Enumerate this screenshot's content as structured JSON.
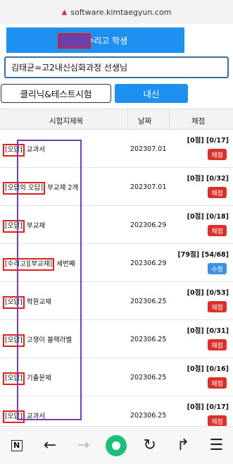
{
  "browser": {
    "url": "software.kimtaegyun.com",
    "warning_icon": "warning-triangle-icon"
  },
  "student": {
    "label": "고2 수리고 학생"
  },
  "teacher": {
    "label": "김태균=고2내신심화과정 선생님"
  },
  "tabs": [
    {
      "label": "클리닉&테스트시험",
      "active": false
    },
    {
      "label": "내신",
      "active": true
    }
  ],
  "table": {
    "headers": [
      "시험지제목",
      "날짜",
      "채점"
    ],
    "rows": [
      {
        "tag": "[오답]",
        "rest": " 교과서",
        "date": "202307.01",
        "score": "[0점] [0/17]",
        "button": "채점",
        "button_color": "#d9302c"
      },
      {
        "tag": "[오답의 오답]",
        "rest": " 부교재 2개",
        "date": "202307.01",
        "score": "[0점] [0/32]",
        "button": "채점",
        "button_color": "#d9302c"
      },
      {
        "tag": "[오답]",
        "rest": " 부교재",
        "date": "202306.29",
        "score": "[0점] [0/18]",
        "button": "채점",
        "button_color": "#d9302c"
      },
      {
        "tag": "[수리고][부교재]",
        "rest": " 세번째",
        "date": "202306.29",
        "score": "[79점] [54/68]",
        "button": "수정",
        "button_color": "#3d8fe0"
      },
      {
        "tag": "[오답]",
        "rest": " 학원교재",
        "date": "202306.25",
        "score": "[0점] [0/53]",
        "button": "채점",
        "button_color": "#d9302c"
      },
      {
        "tag": "[오답]",
        "rest": " 고쟁이 블랙라벨",
        "date": "202306.25",
        "score": "[0점] [0/31]",
        "button": "채점",
        "button_color": "#d9302c"
      },
      {
        "tag": "[오답]",
        "rest": " 기출문제",
        "date": "202306.25",
        "score": "[0점] [0/16]",
        "button": "채점",
        "button_color": "#d9302c"
      },
      {
        "tag": "[오답]",
        "rest": " 교과서",
        "date": "202306.25",
        "score": "[0점] [0/17]",
        "button": "채점",
        "button_color": "#d9302c"
      }
    ]
  },
  "bottom_nav": [
    {
      "name": "naver-n-icon",
      "glyph": "N"
    },
    {
      "name": "back-arrow-icon",
      "glyph": "←"
    },
    {
      "name": "forward-arrow-icon",
      "glyph": "→"
    },
    {
      "name": "home-circle-icon",
      "glyph": ""
    },
    {
      "name": "refresh-icon",
      "glyph": "↻"
    },
    {
      "name": "share-icon",
      "glyph": "↱"
    },
    {
      "name": "menu-icon",
      "glyph": "☰"
    }
  ],
  "colors": {
    "accent": "#1e90f0",
    "highlight_frame": "#6f3fb8",
    "mark": "#e0201e"
  }
}
